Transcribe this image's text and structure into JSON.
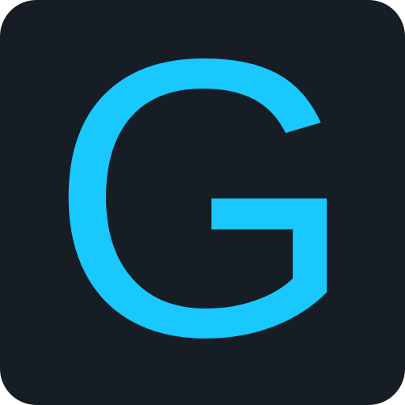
{
  "icon": {
    "letter": "G",
    "colors": {
      "background": "#171D25",
      "letter": "#18C8FF"
    }
  }
}
